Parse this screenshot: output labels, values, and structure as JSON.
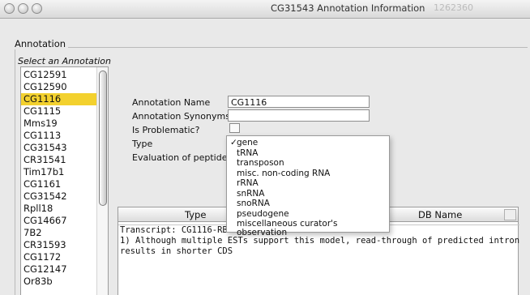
{
  "window": {
    "title": "CG31543 Annotation Information",
    "title_id": "1262360"
  },
  "annotation": {
    "group_label": "Annotation",
    "select_label": "Select an Annotation",
    "list": [
      "CG12591",
      "CG12590",
      "CG1116",
      "CG1115",
      "Mms19",
      "CG1113",
      "CG31543",
      "CR31541",
      "Tim17b1",
      "CG1161",
      "CG31542",
      "Rpll18",
      "CG14667",
      "7B2",
      "CR31593",
      "CG1172",
      "CG12147",
      "Or83b"
    ],
    "selected": "CG1116"
  },
  "form": {
    "name_label": "Annotation Name",
    "name_value": "CG1116",
    "synonyms_label": "Annotation Synonyms",
    "synonyms_value": "",
    "problematic_label": "Is Problematic?",
    "problematic_checked": false,
    "type_label": "Type",
    "peptide_label": "Evaluation of peptide"
  },
  "type_dropdown": {
    "options": [
      "gene",
      "tRNA",
      "transposon",
      "misc. non-coding RNA",
      "rRNA",
      "snRNA",
      "snoRNA",
      "pseudogene",
      "miscellaneous curator's observation"
    ],
    "selected": "gene",
    "check_glyph": "✓"
  },
  "table": {
    "col_type": "Type",
    "col_db": "DB Name",
    "lines": [
      "Transcript: CG1116-RB",
      "1) Although multiple ESTs support this model, read-through of predicted intron",
      "results in shorter CDS"
    ]
  },
  "colors": {
    "selection": "#f3d12e",
    "window_bg": "#e9e9e9"
  }
}
